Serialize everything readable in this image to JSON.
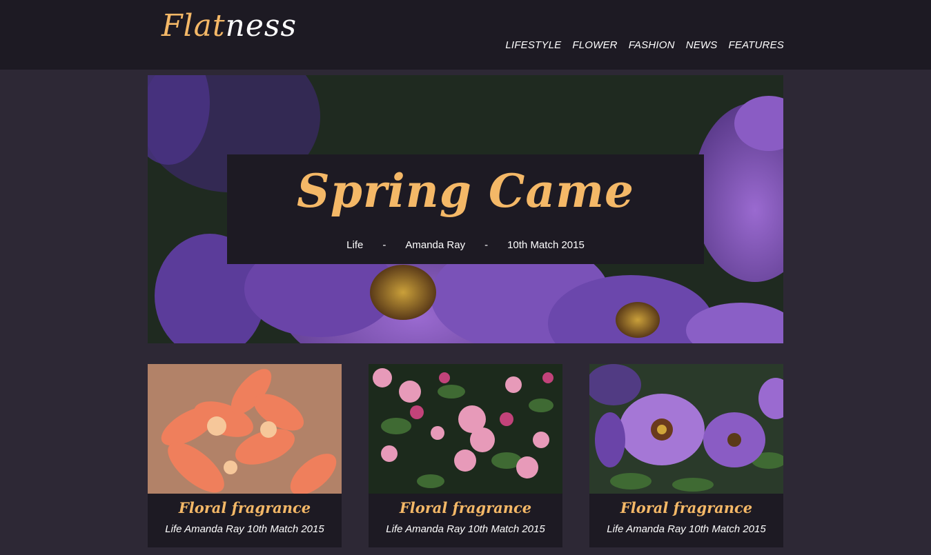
{
  "header": {
    "logo_part1": "Flat",
    "logo_part2": "ness",
    "nav": [
      "LIFESTYLE",
      "FLOWER",
      "FASHION",
      "NEWS",
      "FEATURES"
    ]
  },
  "hero": {
    "title": "Spring Came",
    "category": "Life",
    "separator": "-",
    "author": "Amanda Ray",
    "date": "10th Match 2015"
  },
  "cards": [
    {
      "title": "Floral fragrance",
      "meta": "Life Amanda Ray 10th Match 2015"
    },
    {
      "title": "Floral fragrance",
      "meta": "Life Amanda Ray 10th Match 2015"
    },
    {
      "title": "Floral fragrance",
      "meta": "Life Amanda Ray 10th Match 2015"
    }
  ],
  "colors": {
    "accent": "#f4b867",
    "header_bg": "#1d1a23",
    "page_bg": "#2d2835"
  }
}
